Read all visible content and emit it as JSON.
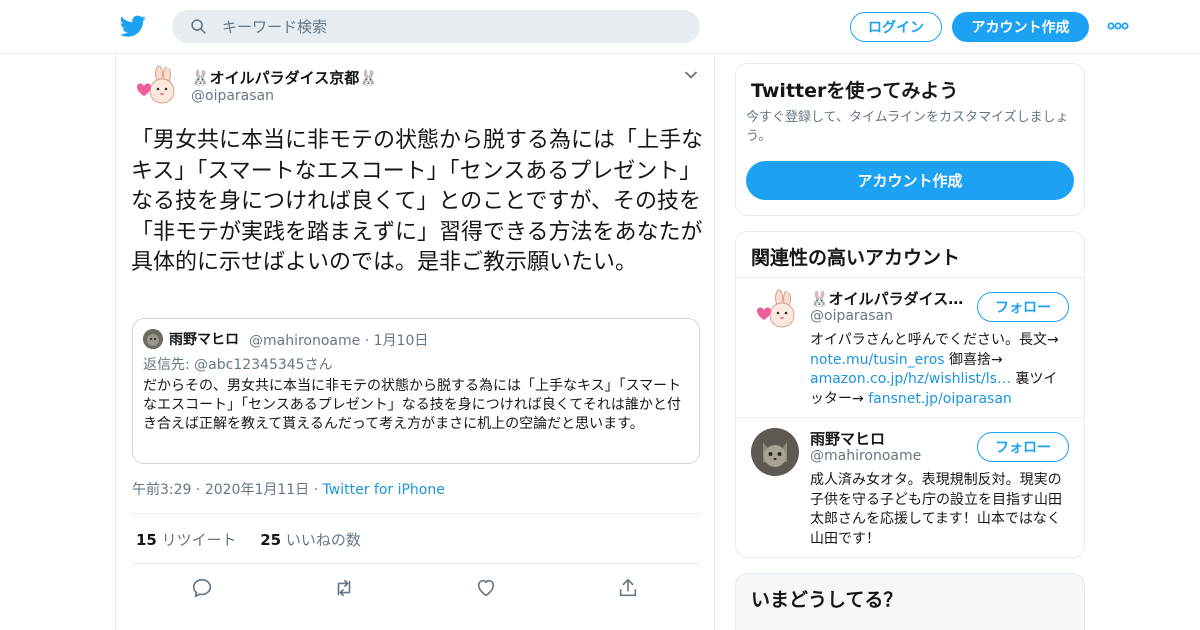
{
  "header": {
    "logo_icon": "twitter-bird-icon",
    "search_placeholder": "キーワード検索",
    "login_label": "ログイン",
    "signup_label": "アカウント作成",
    "more_icon": "more-dots-icon",
    "accent_color": "#1da1f2"
  },
  "tweet": {
    "author_name": "🐰オイルパラダイス京都🐰",
    "author_handle": "@oiparasan",
    "text": "「男女共に本当に非モテの状態から脱する為には「上手なキス」「スマートなエスコート」「センスあるプレゼント」なる技を身につければ良くて」とのことですが、その技を「非モテが実践を踏まえずに」習得できる方法をあなたが具体的に示せばよいのでは。是非ご教示願いたい。",
    "quote": {
      "author_name": "雨野マヒロ",
      "author_handle": "@mahironoame",
      "date": "1月10日",
      "reply_to": "返信先: @abc12345345さん",
      "text": "だからその、男女共に本当に非モテの状態から脱する為には「上手なキス」「スマートなエスコート」「センスあるプレゼント」なる技を身につければ良くてそれは誰かと付き合えば正解を教えて貰えるんだって考え方がまさに机上の空論だと思います。"
    },
    "time": "午前3:29",
    "date": "2020年1月11日",
    "source": "Twitter for iPhone",
    "retweet_count": "15",
    "retweet_label": "リツイート",
    "like_count": "25",
    "like_label": "いいねの数"
  },
  "sidebar": {
    "signup_card": {
      "title": "Twitterを使ってみよう",
      "subtitle": "今すぐ登録して、タイムラインをカスタマイズしましょう。",
      "button": "アカウント作成"
    },
    "related": {
      "title": "関連性の高いアカウント",
      "accounts": [
        {
          "name": "🐰オイルパラダイス…",
          "handle": "@oiparasan",
          "follow": "フォロー",
          "bio_a": "オイパラさんと呼んでください。長文→ ",
          "bio_link1": "note.mu/tusin_eros",
          "bio_b": " 御喜捨→ ",
          "bio_link2": "amazon.co.jp/hz/wishlist/ls…",
          "bio_c": " 裏ツイッター→ ",
          "bio_link3": "fansnet.jp/oiparasan"
        },
        {
          "name": "雨野マヒロ",
          "handle": "@mahironoame",
          "follow": "フォロー",
          "bio": "成人済み女オタ。表現規制反対。現実の子供を守る子ども庁の設立を目指す山田太郎さんを応援してます！山本ではなく山田です！"
        }
      ]
    },
    "trends": {
      "title": "いまどうしてる？"
    }
  }
}
